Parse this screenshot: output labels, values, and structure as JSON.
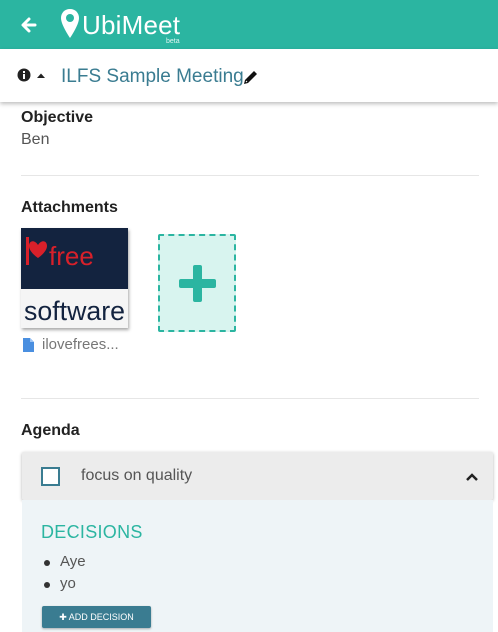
{
  "app": {
    "name": "UbiMeet",
    "tag": "beta",
    "brand_color": "#2bb5a1",
    "accent_color": "#3a7c91"
  },
  "header": {
    "back_icon": "arrow-left-icon",
    "info_icon": "info-icon",
    "caret_icon": "caret-up-icon",
    "meeting_title": "ILFS Sample Meeting",
    "edit_icon": "pencil-icon"
  },
  "objective": {
    "label": "Objective",
    "value": "Ben"
  },
  "attachments": {
    "label": "Attachments",
    "items": [
      {
        "file_name": "ilovefrees...",
        "thumbnail_text_top": "free",
        "thumbnail_text_bottom": "software"
      }
    ],
    "add_icon": "plus-icon"
  },
  "agenda": {
    "label": "Agenda",
    "items": [
      {
        "title": "focus on quality",
        "checked": false,
        "expanded": true,
        "decisions_label": "DECISIONS",
        "decisions": [
          "Aye",
          "yo"
        ],
        "add_decision_label": "ADD DECISION"
      }
    ]
  }
}
